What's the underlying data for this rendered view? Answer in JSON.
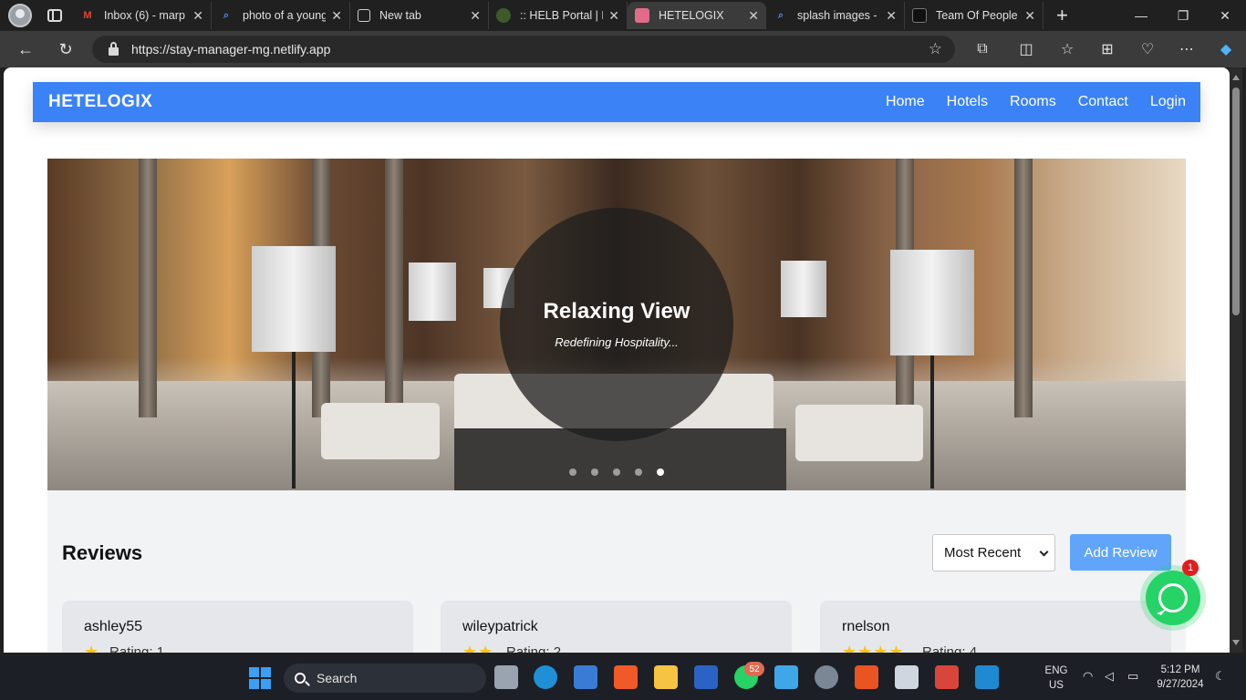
{
  "browser": {
    "tabs": [
      {
        "label": "Inbox (6) - marp",
        "icon": "gmail-icon",
        "color": "#ea4335"
      },
      {
        "label": "photo of a young",
        "icon": "search-icon",
        "color": "#4a90e2"
      },
      {
        "label": "New tab",
        "icon": "newtab-icon",
        "color": "#cfcfcf"
      },
      {
        "label": ":: HELB Portal | M",
        "icon": "helb-icon",
        "color": "#6b8e23"
      },
      {
        "label": "HETELOGIX",
        "icon": "hotel-icon",
        "color": "#e06b8b"
      },
      {
        "label": "splash images - S",
        "icon": "search-icon",
        "color": "#4a90e2"
      },
      {
        "label": "Team Of People",
        "icon": "unsplash-icon",
        "color": "#111111"
      }
    ],
    "url": "https://stay-manager-mg.netlify.app"
  },
  "site": {
    "brand": "HETELOGIX",
    "nav": [
      "Home",
      "Hotels",
      "Rooms",
      "Contact",
      "Login"
    ],
    "hero": {
      "title": "Relaxing View",
      "subtitle": "Redefining Hospitality...",
      "slides": 5,
      "active_slide": 5
    },
    "reviews": {
      "title": "Reviews",
      "sort_value": "Most Recent",
      "add_label": "Add Review",
      "items": [
        {
          "user": "ashley55",
          "rating_text": "Rating: 1",
          "stars": "★"
        },
        {
          "user": "wileypatrick",
          "rating_text": "Rating: 2",
          "stars": "★★"
        },
        {
          "user": "rnelson",
          "rating_text": "Rating: 4",
          "stars": "★★★★"
        }
      ]
    },
    "whatsapp_badge": "1"
  },
  "taskbar": {
    "search_label": "Search",
    "whatsapp_count": "52",
    "lang": "ENG",
    "region": "US",
    "time": "5:12 PM",
    "date": "9/27/2024"
  },
  "colors": {
    "navbar": "#3b82f6",
    "add_review": "#60a5fa",
    "star": "#f5c518",
    "whatsapp": "#25d366"
  }
}
